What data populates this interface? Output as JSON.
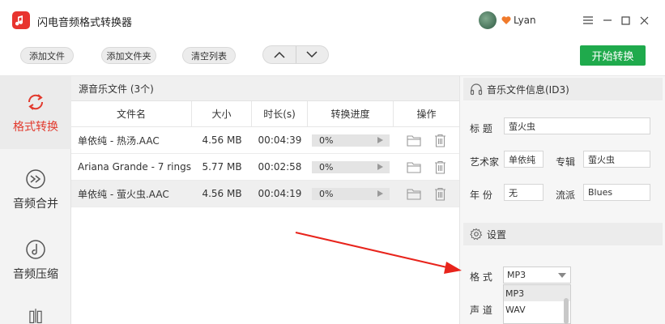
{
  "app": {
    "title": "闪电音频格式转换器",
    "user_name": "Lyan"
  },
  "toolbar": {
    "add_file": "添加文件",
    "add_folder": "添加文件夹",
    "clear_list": "清空列表",
    "start": "开始转换"
  },
  "sidebar": {
    "items": [
      {
        "label": "格式转换",
        "icon": "refresh-icon",
        "active": true
      },
      {
        "label": "音频合并",
        "icon": "merge-icon",
        "active": false
      },
      {
        "label": "音频压缩",
        "icon": "compress-icon",
        "active": false
      },
      {
        "label": "",
        "icon": "split-icon",
        "active": false
      }
    ]
  },
  "file_panel": {
    "header": "源音乐文件 (3个)",
    "columns": [
      "文件名",
      "大小",
      "时长(s)",
      "转换进度",
      "操作"
    ],
    "rows": [
      {
        "name": "单依纯 - 热汤.AAC",
        "size": "4.56 MB",
        "duration": "00:04:39",
        "progress": "0%",
        "progress_value": 0
      },
      {
        "name": "Ariana Grande - 7 rings....",
        "size": "5.77 MB",
        "duration": "00:02:58",
        "progress": "0%",
        "progress_value": 0
      },
      {
        "name": "单依纯 - 萤火虫.AAC",
        "size": "4.56 MB",
        "duration": "00:04:19",
        "progress": "0%",
        "progress_value": 0
      }
    ]
  },
  "id3": {
    "header": "音乐文件信息(ID3)",
    "title_label": "标 题",
    "title_value": "萤火虫",
    "artist_label": "艺术家",
    "artist_value": "单依纯",
    "album_label": "专辑",
    "album_value": "萤火虫",
    "year_label": "年 份",
    "year_value": "无",
    "genre_label": "流派",
    "genre_value": "Blues"
  },
  "settings": {
    "header": "设置",
    "format_label": "格 式",
    "format_value": "MP3",
    "channel_label": "声 道",
    "options": [
      "MP3",
      "WAV"
    ]
  },
  "colors": {
    "accent": "#1faa4c",
    "brand": "#e8342f",
    "active_text": "#e23a2e"
  }
}
